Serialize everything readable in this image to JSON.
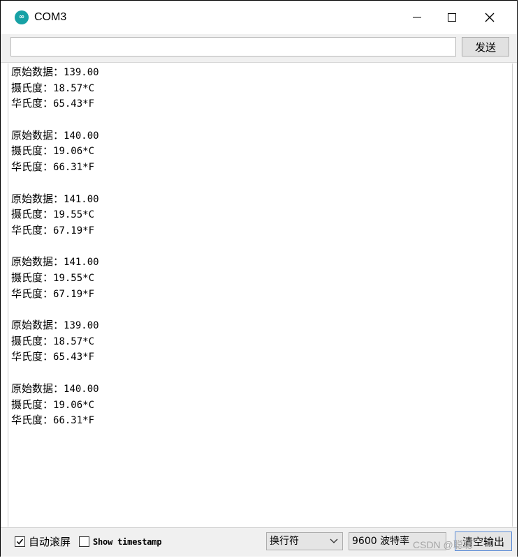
{
  "window": {
    "title": "COM3"
  },
  "send": {
    "input_value": "",
    "button_label": "发送"
  },
  "output": {
    "lines": [
      {
        "label": "原始数据：",
        "value": "139.00"
      },
      {
        "label": "摄氏度：",
        "value": "18.57*C"
      },
      {
        "label": "华氏度：",
        "value": "65.43*F"
      },
      {
        "label": "原始数据：",
        "value": "140.00"
      },
      {
        "label": "摄氏度：",
        "value": "19.06*C"
      },
      {
        "label": "华氏度：",
        "value": "66.31*F"
      },
      {
        "label": "原始数据：",
        "value": "141.00"
      },
      {
        "label": "摄氏度：",
        "value": "19.55*C"
      },
      {
        "label": "华氏度：",
        "value": "67.19*F"
      },
      {
        "label": "原始数据：",
        "value": "141.00"
      },
      {
        "label": "摄氏度：",
        "value": "19.55*C"
      },
      {
        "label": "华氏度：",
        "value": "67.19*F"
      },
      {
        "label": "原始数据：",
        "value": "139.00"
      },
      {
        "label": "摄氏度：",
        "value": "18.57*C"
      },
      {
        "label": "华氏度：",
        "value": "65.43*F"
      },
      {
        "label": "原始数据：",
        "value": "140.00"
      },
      {
        "label": "摄氏度：",
        "value": "19.06*C"
      },
      {
        "label": "华氏度：",
        "value": "66.31*F"
      }
    ]
  },
  "bottom": {
    "autoscroll_label": "自动滚屏",
    "autoscroll_checked": true,
    "timestamp_label": "Show timestamp",
    "timestamp_checked": false,
    "line_ending": "换行符",
    "baud_rate": "9600 波特率",
    "clear_label": "清空输出",
    "watermark": "CSDN @聪聪"
  }
}
